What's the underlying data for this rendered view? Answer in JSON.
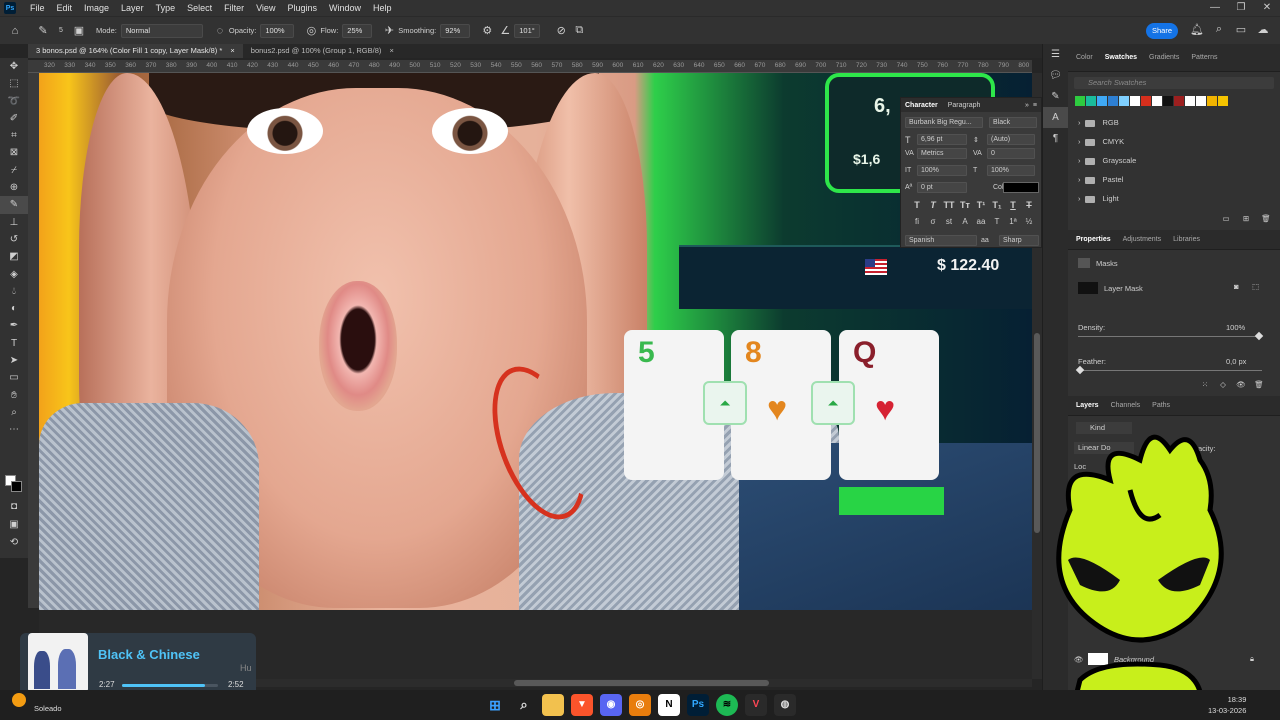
{
  "menubar": {
    "items": [
      "File",
      "Edit",
      "Image",
      "Layer",
      "Type",
      "Select",
      "Filter",
      "View",
      "Plugins",
      "Window",
      "Help"
    ]
  },
  "options": {
    "mode_label": "Mode:",
    "mode_value": "Normal",
    "opacity_label": "Opacity:",
    "opacity_value": "100%",
    "flow_label": "Flow:",
    "flow_value": "25%",
    "smoothing_label": "Smoothing:",
    "smoothing_value": "92%",
    "angle_value": "101°",
    "brush_size": "5",
    "share_label": "Share"
  },
  "tabs": [
    {
      "label": "3 bonos.psd @ 164% (Color Fill 1 copy, Layer Mask/8) *",
      "active": true
    },
    {
      "label": "bonus2.psd @ 100% (Group 1, RGB/8)",
      "active": false
    }
  ],
  "ruler_ticks": [
    "320",
    "330",
    "340",
    "350",
    "360",
    "370",
    "380",
    "390",
    "400",
    "410",
    "420",
    "430",
    "440",
    "450",
    "460",
    "470",
    "480",
    "490",
    "500",
    "510",
    "520",
    "530",
    "540",
    "550",
    "560",
    "570",
    "580",
    "590",
    "600",
    "610",
    "620",
    "630",
    "640",
    "650",
    "660",
    "670",
    "680",
    "690",
    "700",
    "710",
    "720",
    "730",
    "740",
    "750",
    "760",
    "770",
    "780",
    "790",
    "800",
    "810"
  ],
  "canvas": {
    "amount_top": "6,",
    "amount_sub": "$1,6",
    "balance": "$ 122.40",
    "cards": [
      "5",
      "8",
      "Q"
    ],
    "suits": [
      "♥",
      "♥"
    ]
  },
  "character": {
    "tab_character": "Character",
    "tab_paragraph": "Paragraph",
    "font_family": "Burbank Big Regu...",
    "font_style": "Black",
    "font_size": "6,96 pt",
    "leading": "(Auto)",
    "kerning": "Metrics",
    "tracking": "0",
    "vscale": "100%",
    "hscale": "100%",
    "baseline": "0 pt",
    "color_label": "Color:",
    "language": "Spanish",
    "antialias": "Sharp"
  },
  "swatches": {
    "tabs": [
      "Color",
      "Swatches",
      "Gradients",
      "Patterns"
    ],
    "search_placeholder": "Search Swatches",
    "chip_colors": [
      "#2ecc40",
      "#1abc9c",
      "#3fa9f5",
      "#2d7fd3",
      "#7fd0ff",
      "#ffffff",
      "#d62f1d",
      "#ffffff",
      "#111111",
      "#9c1f1f",
      "#ffffff",
      "#ffffff",
      "#f2b400",
      "#f5c400"
    ],
    "folders": [
      "RGB",
      "CMYK",
      "Grayscale",
      "Pastel",
      "Light"
    ]
  },
  "properties": {
    "tabs": [
      "Properties",
      "Adjustments",
      "Libraries"
    ],
    "masks_label": "Masks",
    "layer_mask_label": "Layer Mask",
    "density_label": "Density:",
    "density_value": "100%",
    "feather_label": "Feather:",
    "feather_value": "0,0 px"
  },
  "layers": {
    "tabs": [
      "Layers",
      "Channels",
      "Paths"
    ],
    "filter_kind": "Kind",
    "blend_mode": "Linear Do",
    "opacity_label": "Opacity:",
    "lock_label": "Loc",
    "background_layer": "Background"
  },
  "now_playing": {
    "title": "Black & Chinese",
    "trail": "Hu",
    "elapsed": "2:27",
    "total": "2:52",
    "progress": 0.86
  },
  "taskbar": {
    "weather_label": "Soleado",
    "time": "18:39",
    "date": "13-03-2026"
  }
}
